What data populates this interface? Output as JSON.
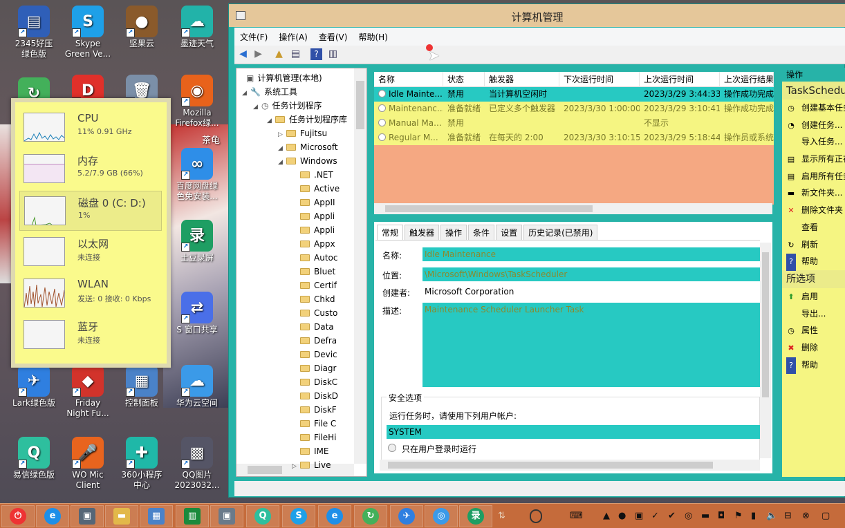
{
  "desktop": {
    "icons": [
      {
        "label": "2345好压\n绿色版",
        "color": "#2f5fb8",
        "glyph": "▤"
      },
      {
        "label": "Skype\nGreen Ve...",
        "color": "#1ea0e8",
        "glyph": "S"
      },
      {
        "label": "坚果云",
        "color": "#8a5a2b",
        "glyph": "●"
      },
      {
        "label": "墨迹天气",
        "color": "#22b3a9",
        "glyph": "☁"
      },
      {
        "label": "",
        "color": "#43b05a",
        "glyph": "↻"
      },
      {
        "label": "",
        "color": "#e0302a",
        "glyph": "D"
      },
      {
        "label": "",
        "color": "#7b8fa8",
        "glyph": "🗑"
      },
      {
        "label": "Mozilla\nFirefox绿...",
        "color": "#e8621b",
        "glyph": "◉"
      },
      {
        "label": "百度网盘绿\n色免安装...",
        "color": "#2e8ee8",
        "glyph": "∞"
      },
      {
        "label": "土豆录屏",
        "color": "#1e9e63",
        "glyph": "录"
      },
      {
        "label": "S 窗口共享",
        "color": "#4a6fe8",
        "glyph": "⇄"
      },
      {
        "label": "Lark绿色版",
        "color": "#2f7fe0",
        "glyph": "✈"
      },
      {
        "label": "Friday\nNight Fu...",
        "color": "#d2332b",
        "glyph": "◆"
      },
      {
        "label": "控制面板",
        "color": "#4a82c8",
        "glyph": "▦"
      },
      {
        "label": "华为云空间",
        "color": "#3b9ae8",
        "glyph": "☁"
      },
      {
        "label": "易信绿色版",
        "color": "#2ebf9e",
        "glyph": "Q"
      },
      {
        "label": "WO Mic\nClient",
        "color": "#e8641e",
        "glyph": "🎤"
      },
      {
        "label": "360小程序\n中心",
        "color": "#1fb8a8",
        "glyph": "✚"
      },
      {
        "label": "QQ图片\n2023032...",
        "color": "#556",
        "glyph": "▩"
      }
    ],
    "corner_text": "茶龟"
  },
  "task_manager": {
    "items": [
      {
        "title": "CPU",
        "sub": "11% 0.91 GHz"
      },
      {
        "title": "内存",
        "sub": "5.2/7.9 GB (66%)"
      },
      {
        "title": "磁盘 0 (C: D:)",
        "sub": "1%"
      },
      {
        "title": "以太网",
        "sub": "未连接"
      },
      {
        "title": "WLAN",
        "sub": "发送: 0 接收: 0 Kbps"
      },
      {
        "title": "蓝牙",
        "sub": "未连接"
      }
    ]
  },
  "window": {
    "title": "计算机管理",
    "menu": [
      "文件(F)",
      "操作(A)",
      "查看(V)",
      "帮助(H)"
    ],
    "tree": [
      {
        "label": "计算机管理(本地)",
        "level": 0,
        "arrow": "",
        "icon": "computer"
      },
      {
        "label": "系统工具",
        "level": 1,
        "arrow": "◢",
        "icon": "tools"
      },
      {
        "label": "任务计划程序",
        "level": 2,
        "arrow": "◢",
        "icon": "clock"
      },
      {
        "label": "任务计划程序库",
        "level": 3,
        "arrow": "◢",
        "icon": "folder"
      },
      {
        "label": "Fujitsu",
        "level": 4,
        "arrow": "▷",
        "icon": "folder"
      },
      {
        "label": "Microsoft",
        "level": 4,
        "arrow": "◢",
        "icon": "folder"
      },
      {
        "label": "Windows",
        "level": 5,
        "arrow": "◢",
        "icon": "folder"
      },
      {
        "label": ".NET",
        "level": 6,
        "arrow": "",
        "icon": "folder"
      },
      {
        "label": "Active",
        "level": 6,
        "arrow": "",
        "icon": "folder"
      },
      {
        "label": "AppII",
        "level": 6,
        "arrow": "",
        "icon": "folder"
      },
      {
        "label": "Appli",
        "level": 6,
        "arrow": "",
        "icon": "folder"
      },
      {
        "label": "Appli",
        "level": 6,
        "arrow": "",
        "icon": "folder"
      },
      {
        "label": "Appx",
        "level": 6,
        "arrow": "",
        "icon": "folder"
      },
      {
        "label": "Autoc",
        "level": 6,
        "arrow": "",
        "icon": "folder"
      },
      {
        "label": "Bluet",
        "level": 6,
        "arrow": "",
        "icon": "folder"
      },
      {
        "label": "Certif",
        "level": 6,
        "arrow": "",
        "icon": "folder"
      },
      {
        "label": "Chkd",
        "level": 6,
        "arrow": "",
        "icon": "folder"
      },
      {
        "label": "Custo",
        "level": 6,
        "arrow": "",
        "icon": "folder"
      },
      {
        "label": "Data",
        "level": 6,
        "arrow": "",
        "icon": "folder"
      },
      {
        "label": "Defra",
        "level": 6,
        "arrow": "",
        "icon": "folder"
      },
      {
        "label": "Devic",
        "level": 6,
        "arrow": "",
        "icon": "folder"
      },
      {
        "label": "Diagr",
        "level": 6,
        "arrow": "",
        "icon": "folder"
      },
      {
        "label": "DiskC",
        "level": 6,
        "arrow": "",
        "icon": "folder"
      },
      {
        "label": "DiskD",
        "level": 6,
        "arrow": "",
        "icon": "folder"
      },
      {
        "label": "DiskF",
        "level": 6,
        "arrow": "",
        "icon": "folder"
      },
      {
        "label": "File C",
        "level": 6,
        "arrow": "",
        "icon": "folder"
      },
      {
        "label": "FileHi",
        "level": 6,
        "arrow": "",
        "icon": "folder"
      },
      {
        "label": "IME",
        "level": 6,
        "arrow": "",
        "icon": "folder"
      },
      {
        "label": "Live",
        "level": 6,
        "arrow": "▷",
        "icon": "folder"
      }
    ],
    "task_columns": [
      "名称",
      "状态",
      "触发器",
      "下次运行时间",
      "上次运行时间",
      "上次运行结果"
    ],
    "tasks": [
      [
        "Idle Mainte...",
        "禁用",
        "当计算机空闲时",
        "",
        "2023/3/29 3:44:33",
        "操作成功完成"
      ],
      [
        "Maintenanc...",
        "准备就绪",
        "已定义多个触发器",
        "2023/3/30 1:00:00",
        "2023/3/29 3:10:41",
        "操作成功完成"
      ],
      [
        "Manual Ma...",
        "禁用",
        "",
        "",
        "不显示",
        ""
      ],
      [
        "Regular M...",
        "准备就绪",
        "在每天的 2:00",
        "2023/3/30 3:10:15",
        "2023/3/29 5:18:44",
        "操作员或系统"
      ]
    ],
    "tabs": [
      "常规",
      "触发器",
      "操作",
      "条件",
      "设置",
      "历史记录(已禁用)"
    ],
    "detail": {
      "name_label": "名称:",
      "name": "Idle Maintenance",
      "location_label": "位置:",
      "location": "\\Microsoft\\Windows\\TaskScheduler",
      "author_label": "创建者:",
      "author": "Microsoft Corporation",
      "desc_label": "描述:",
      "desc": "Maintenance Scheduler Launcher Task",
      "security_label": "安全选项",
      "run_as_label": "运行任务时，请使用下列用户帐户:",
      "run_as": "SYSTEM",
      "only_logged_on": "只在用户登录时运行"
    },
    "actions": {
      "header": "操作",
      "group1": "TaskScheduler",
      "items1": [
        {
          "label": "创建基本任务...",
          "icon": "◷"
        },
        {
          "label": "创建任务...",
          "icon": "◔"
        },
        {
          "label": "导入任务...",
          "icon": ""
        },
        {
          "label": "显示所有正在运行的任务",
          "icon": "▤"
        },
        {
          "label": "启用所有任务历史记录",
          "icon": "▤"
        },
        {
          "label": "新文件夹...",
          "icon": "▬"
        },
        {
          "label": "删除文件夹",
          "icon": "✕"
        },
        {
          "label": "查看",
          "icon": ""
        },
        {
          "label": "刷新",
          "icon": "↻"
        },
        {
          "label": "帮助",
          "icon": "?"
        }
      ],
      "group2": "所选项",
      "items2": [
        {
          "label": "启用",
          "icon": "⬆"
        },
        {
          "label": "导出...",
          "icon": ""
        },
        {
          "label": "属性",
          "icon": "◷"
        },
        {
          "label": "删除",
          "icon": "✖"
        },
        {
          "label": "帮助",
          "icon": "?"
        }
      ]
    }
  },
  "colors": {
    "accent": "#27b3a8",
    "highlight": "#f5f582",
    "selected": "#27c9c2",
    "taskbar": "#c56b3b"
  }
}
